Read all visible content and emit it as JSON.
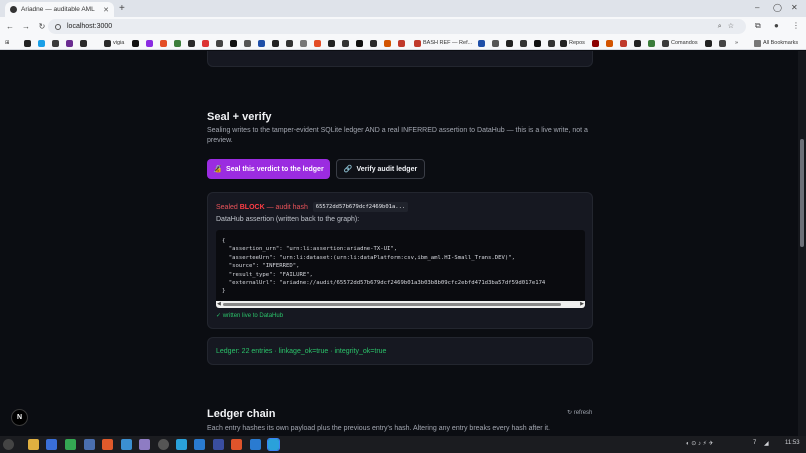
{
  "browser": {
    "tab_title": "Ariadne — auditable AML",
    "url": "localhost:3000",
    "bookmarks": [
      {
        "label": "",
        "color": "#222222"
      },
      {
        "label": "",
        "color": "#1aa0e8"
      },
      {
        "label": "",
        "color": "#3b3b3b"
      },
      {
        "label": "",
        "color": "#6a2c91"
      },
      {
        "label": "vigia",
        "color": "#2a2a2a"
      },
      {
        "label": "",
        "color": "#111111"
      },
      {
        "label": "",
        "color": "#8a2be2"
      },
      {
        "label": "",
        "color": "#e44d26"
      },
      {
        "label": "",
        "color": "#3b7d3b"
      },
      {
        "label": "",
        "color": "#2a2a2a"
      },
      {
        "label": "",
        "color": "#d33"
      },
      {
        "label": "BASH REF — Ref...",
        "color": "#c0392b"
      },
      {
        "label": "Repos",
        "color": "#222222"
      },
      {
        "label": "Comandos",
        "color": "#3b3b3b"
      }
    ],
    "all_bookmarks": "All Bookmarks"
  },
  "seal_section": {
    "heading": "Seal + verify",
    "description": "Sealing writes to the tamper-evident SQLite ledger AND a real INFERRED assertion to DataHub — this is a live write, not a preview.",
    "seal_button": "Seal this verdict to the ledger",
    "verify_button": "Verify audit ledger",
    "seal_icon": "lock-icon",
    "verify_icon": "link-icon"
  },
  "result": {
    "sealed_prefix": "Sealed",
    "verdict": "BLOCK",
    "hash_label": "— audit hash",
    "hash_value": "65572dd57b679dcf2469b01a...",
    "assertion_title": "DataHub assertion (written back to the graph):",
    "assertion_json": "{\n  \"assertion_urn\": \"urn:li:assertion:ariadne-TX-UI\",\n  \"asserteeUrn\": \"urn:li:dataset:(urn:li:dataPlatform:csv,ibm_aml.HI-Small_Trans.DEV)\",\n  \"source\": \"INFERRED\",\n  \"result_type\": \"FAILURE\",\n  \"externalUrl\": \"ariadne://audit/65572dd57b679dcf2469b01a3b03b8b09cfc2ebfd471d3ba57df59d017e174\n}",
    "live_note": "✓ written live to DataHub"
  },
  "ledger": {
    "status": "Ledger: 22 entries · linkage_ok=true · integrity_ok=true"
  },
  "ledger_chain": {
    "heading": "Ledger chain",
    "refresh": "↻ refresh",
    "description": "Each entry hashes its own payload plus the previous entry's hash. Altering any entry breaks every hash after it."
  },
  "badge": "N",
  "taskbar": {
    "clock": "11:53",
    "battery": "7"
  }
}
